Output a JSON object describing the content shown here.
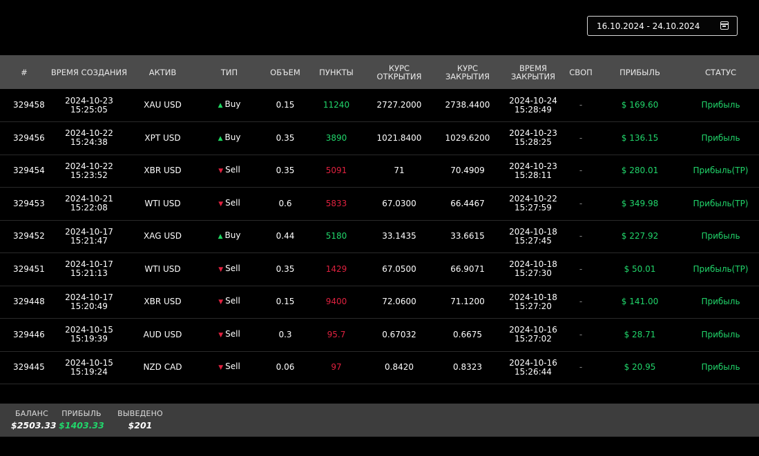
{
  "date_filter": {
    "value": "16.10.2024 - 24.10.2024",
    "icon": "calendar-icon"
  },
  "columns": [
    "#",
    "ВРЕМЯ СОЗДАНИЯ",
    "АКТИВ",
    "ТИП",
    "ОБЪЕМ",
    "ПУНКТЫ",
    "КУРС ОТКРЫТИЯ",
    "КУРС ЗАКРЫТИЯ",
    "ВРЕМЯ ЗАКРЫТИЯ",
    "СВОП",
    "ПРИБЫЛЬ",
    "СТАТУС"
  ],
  "colors": {
    "profit": "#21d66b",
    "loss": "#e0213f",
    "header_bg": "#4b4b4b",
    "footer_bg": "#3d3d3d"
  },
  "rows": [
    {
      "id": "329458",
      "created_date": "2024-10-23",
      "created_time": "15:25:05",
      "asset": "XAU USD",
      "type": "Buy",
      "volume": "0.15",
      "points": "11240",
      "open": "2727.2000",
      "close": "2738.4400",
      "closed_date": "2024-10-24",
      "closed_time": "15:28:49",
      "swap": "-",
      "profit": "$ 169.60",
      "status": "Прибыль"
    },
    {
      "id": "329456",
      "created_date": "2024-10-22",
      "created_time": "15:24:38",
      "asset": "XPT USD",
      "type": "Buy",
      "volume": "0.35",
      "points": "3890",
      "open": "1021.8400",
      "close": "1029.6200",
      "closed_date": "2024-10-23",
      "closed_time": "15:28:25",
      "swap": "-",
      "profit": "$ 136.15",
      "status": "Прибыль"
    },
    {
      "id": "329454",
      "created_date": "2024-10-22",
      "created_time": "15:23:52",
      "asset": "XBR USD",
      "type": "Sell",
      "volume": "0.35",
      "points": "5091",
      "open": "71",
      "close": "70.4909",
      "closed_date": "2024-10-23",
      "closed_time": "15:28:11",
      "swap": "-",
      "profit": "$ 280.01",
      "status": "Прибыль(TP)"
    },
    {
      "id": "329453",
      "created_date": "2024-10-21",
      "created_time": "15:22:08",
      "asset": "WTI USD",
      "type": "Sell",
      "volume": "0.6",
      "points": "5833",
      "open": "67.0300",
      "close": "66.4467",
      "closed_date": "2024-10-22",
      "closed_time": "15:27:59",
      "swap": "-",
      "profit": "$ 349.98",
      "status": "Прибыль(TP)"
    },
    {
      "id": "329452",
      "created_date": "2024-10-17",
      "created_time": "15:21:47",
      "asset": "XAG USD",
      "type": "Buy",
      "volume": "0.44",
      "points": "5180",
      "open": "33.1435",
      "close": "33.6615",
      "closed_date": "2024-10-18",
      "closed_time": "15:27:45",
      "swap": "-",
      "profit": "$ 227.92",
      "status": "Прибыль"
    },
    {
      "id": "329451",
      "created_date": "2024-10-17",
      "created_time": "15:21:13",
      "asset": "WTI USD",
      "type": "Sell",
      "volume": "0.35",
      "points": "1429",
      "open": "67.0500",
      "close": "66.9071",
      "closed_date": "2024-10-18",
      "closed_time": "15:27:30",
      "swap": "-",
      "profit": "$ 50.01",
      "status": "Прибыль(TP)"
    },
    {
      "id": "329448",
      "created_date": "2024-10-17",
      "created_time": "15:20:49",
      "asset": "XBR USD",
      "type": "Sell",
      "volume": "0.15",
      "points": "9400",
      "open": "72.0600",
      "close": "71.1200",
      "closed_date": "2024-10-18",
      "closed_time": "15:27:20",
      "swap": "-",
      "profit": "$ 141.00",
      "status": "Прибыль"
    },
    {
      "id": "329446",
      "created_date": "2024-10-15",
      "created_time": "15:19:39",
      "asset": "AUD USD",
      "type": "Sell",
      "volume": "0.3",
      "points": "95.7",
      "open": "0.67032",
      "close": "0.6675",
      "closed_date": "2024-10-16",
      "closed_time": "15:27:02",
      "swap": "-",
      "profit": "$ 28.71",
      "status": "Прибыль"
    },
    {
      "id": "329445",
      "created_date": "2024-10-15",
      "created_time": "15:19:24",
      "asset": "NZD CAD",
      "type": "Sell",
      "volume": "0.06",
      "points": "97",
      "open": "0.8420",
      "close": "0.8323",
      "closed_date": "2024-10-16",
      "closed_time": "15:26:44",
      "swap": "-",
      "profit": "$ 20.95",
      "status": "Прибыль"
    }
  ],
  "summary": {
    "balance_label": "БАЛАНС",
    "balance": "$2503.33",
    "profit_label": "ПРИБЫЛЬ",
    "profit": "$1403.33",
    "withdrawn_label": "ВЫВЕДЕНО",
    "withdrawn": "$201"
  }
}
